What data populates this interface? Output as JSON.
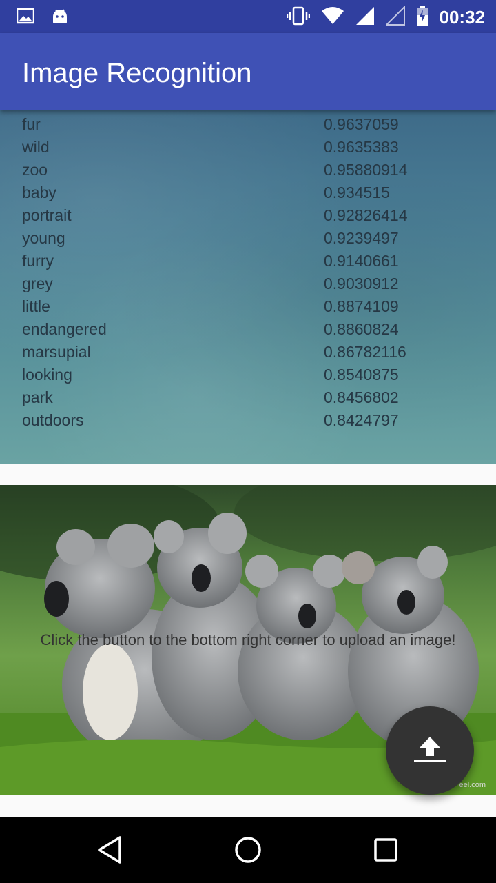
{
  "status_bar": {
    "time": "00:32",
    "left_icons": [
      "image-notification-icon",
      "android-icon"
    ],
    "right_icons": [
      "vibrate-icon",
      "wifi-icon",
      "signal-icon",
      "no-signal-icon",
      "battery-charging-icon"
    ]
  },
  "app_bar": {
    "title": "Image Recognition",
    "color": "#3f51b5"
  },
  "results": [
    {
      "label": "fur",
      "score": "0.9637059"
    },
    {
      "label": "wild",
      "score": "0.9635383"
    },
    {
      "label": "zoo",
      "score": "0.95880914"
    },
    {
      "label": "baby",
      "score": "0.934515"
    },
    {
      "label": "portrait",
      "score": "0.92826414"
    },
    {
      "label": "young",
      "score": "0.9239497"
    },
    {
      "label": "furry",
      "score": "0.9140661"
    },
    {
      "label": "grey",
      "score": "0.9030912"
    },
    {
      "label": "little",
      "score": "0.8874109"
    },
    {
      "label": "endangered",
      "score": "0.8860824"
    },
    {
      "label": "marsupial",
      "score": "0.86782116"
    },
    {
      "label": "looking",
      "score": "0.8540875"
    },
    {
      "label": "park",
      "score": "0.8456802"
    },
    {
      "label": "outdoors",
      "score": "0.8424797"
    }
  ],
  "image_card": {
    "hint": "Click the button to the bottom right corner to upload an image!",
    "watermark": "eel.com"
  },
  "fab": {
    "icon": "upload-icon"
  },
  "nav_bar": {
    "icons": [
      "back-icon",
      "home-icon",
      "recents-icon"
    ]
  }
}
